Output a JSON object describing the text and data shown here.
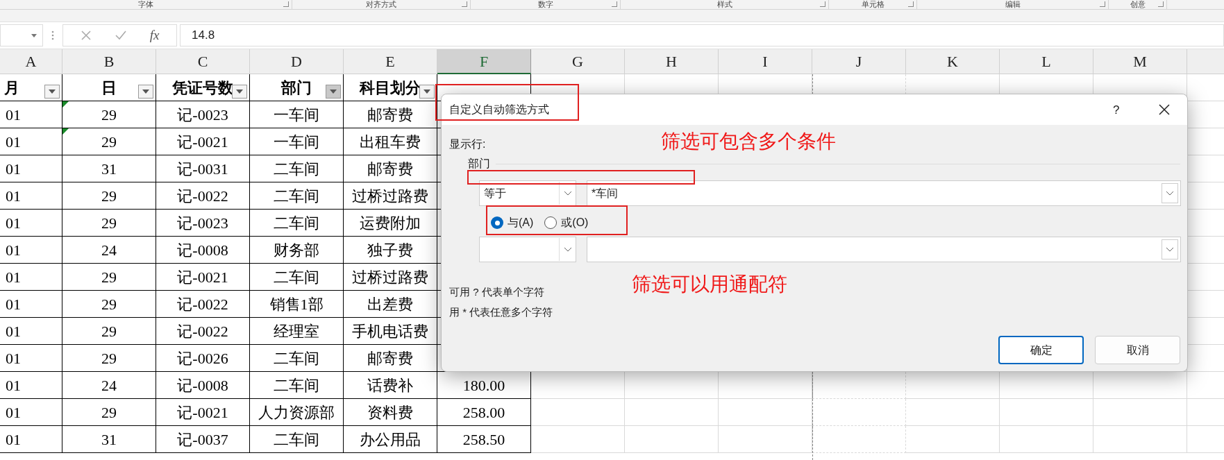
{
  "ribbon_groups": [
    "字体",
    "对齐方式",
    "数字",
    "样式",
    "单元格",
    "编辑",
    "创意"
  ],
  "formula_bar": {
    "function_label": "fx",
    "value": "14.8"
  },
  "columns": [
    {
      "label": "A",
      "selected": false
    },
    {
      "label": "B",
      "selected": false
    },
    {
      "label": "C",
      "selected": false
    },
    {
      "label": "D",
      "selected": false
    },
    {
      "label": "E",
      "selected": false
    },
    {
      "label": "F",
      "selected": true
    },
    {
      "label": "G",
      "selected": false
    },
    {
      "label": "H",
      "selected": false
    },
    {
      "label": "I",
      "selected": false
    },
    {
      "label": "J",
      "selected": false
    },
    {
      "label": "K",
      "selected": false
    },
    {
      "label": "L",
      "selected": false
    },
    {
      "label": "M",
      "selected": false
    }
  ],
  "headers": [
    {
      "label": "月",
      "filter_active": false
    },
    {
      "label": "日",
      "filter_active": false
    },
    {
      "label": "凭证号数",
      "filter_active": false
    },
    {
      "label": "部门",
      "filter_active": true
    },
    {
      "label": "科目划分",
      "filter_active": false
    }
  ],
  "rows": [
    {
      "cells": [
        "01",
        "29",
        "记-0023",
        "一车间",
        "邮寄费"
      ],
      "flag": true
    },
    {
      "cells": [
        "01",
        "29",
        "记-0021",
        "一车间",
        "出租车费"
      ],
      "flag": true
    },
    {
      "cells": [
        "01",
        "31",
        "记-0031",
        "二车间",
        "邮寄费"
      ],
      "flag": false
    },
    {
      "cells": [
        "01",
        "29",
        "记-0022",
        "二车间",
        "过桥过路费"
      ],
      "flag": false
    },
    {
      "cells": [
        "01",
        "29",
        "记-0023",
        "二车间",
        "运费附加"
      ],
      "flag": false
    },
    {
      "cells": [
        "01",
        "24",
        "记-0008",
        "财务部",
        "独子费"
      ],
      "flag": false
    },
    {
      "cells": [
        "01",
        "29",
        "记-0021",
        "二车间",
        "过桥过路费"
      ],
      "flag": false
    },
    {
      "cells": [
        "01",
        "29",
        "记-0022",
        "销售1部",
        "出差费"
      ],
      "flag": false
    },
    {
      "cells": [
        "01",
        "29",
        "记-0022",
        "经理室",
        "手机电话费"
      ],
      "flag": false
    },
    {
      "cells": [
        "01",
        "29",
        "记-0026",
        "二车间",
        "邮寄费"
      ],
      "flag": false
    },
    {
      "cells": [
        "01",
        "24",
        "记-0008",
        "二车间",
        "话费补"
      ],
      "amount": "180.00",
      "flag": false
    },
    {
      "cells": [
        "01",
        "29",
        "记-0021",
        "人力资源部",
        "资料费"
      ],
      "amount": "258.00",
      "flag": false
    },
    {
      "cells": [
        "01",
        "31",
        "记-0037",
        "二车间",
        "办公用品"
      ],
      "amount": "258.50",
      "flag": false
    }
  ],
  "dialog": {
    "title": "自定义自动筛选方式",
    "help": "?",
    "show_rows_label": "显示行:",
    "field_label": "部门",
    "condition_1": {
      "operator": "等于",
      "value": "*车间"
    },
    "logic": [
      {
        "label": "与(A)",
        "selected": true
      },
      {
        "label": "或(O)",
        "selected": false
      }
    ],
    "hints": [
      "可用 ? 代表单个字符",
      "用 * 代表任意多个字符"
    ],
    "buttons": [
      {
        "label": "确定",
        "kind": "default"
      },
      {
        "label": "取消",
        "kind": "normal"
      }
    ]
  },
  "annotations": [
    "筛选可包含多个条件",
    "筛选可以用通配符"
  ]
}
